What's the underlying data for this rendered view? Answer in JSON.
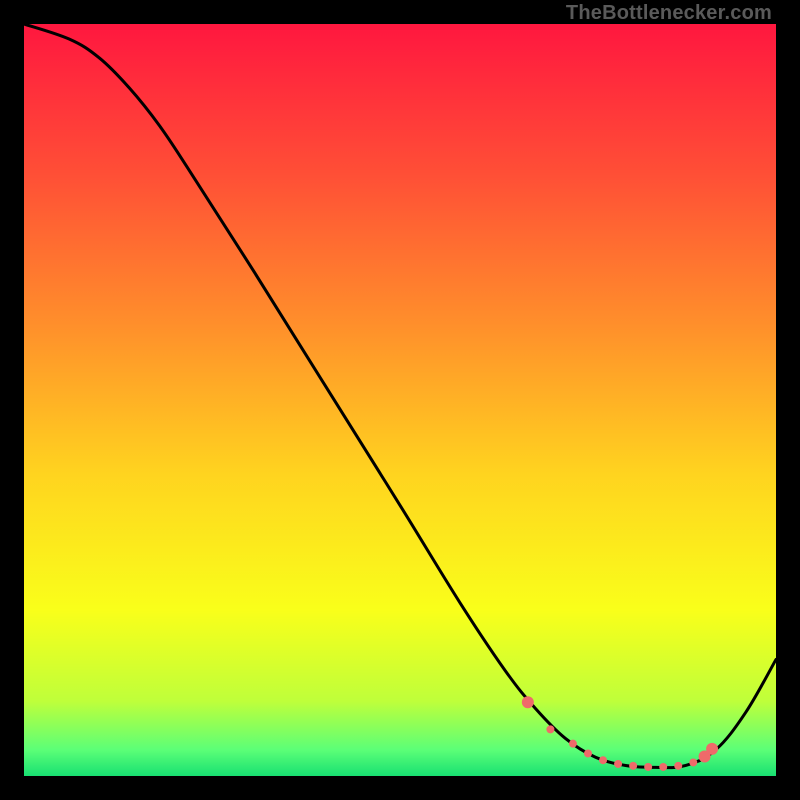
{
  "watermark": "TheBottlenecker.com",
  "chart_data": {
    "type": "line",
    "title": "",
    "xlabel": "",
    "ylabel": "",
    "xlim": [
      0,
      100
    ],
    "ylim": [
      0,
      100
    ],
    "grid": false,
    "legend": false,
    "background_gradient": {
      "stops": [
        {
          "offset": 0.0,
          "color": "#ff173f"
        },
        {
          "offset": 0.2,
          "color": "#ff4f36"
        },
        {
          "offset": 0.4,
          "color": "#ff8f2b"
        },
        {
          "offset": 0.6,
          "color": "#ffd41f"
        },
        {
          "offset": 0.78,
          "color": "#f9ff1a"
        },
        {
          "offset": 0.9,
          "color": "#bfff3a"
        },
        {
          "offset": 0.965,
          "color": "#5cff77"
        },
        {
          "offset": 1.0,
          "color": "#18e072"
        }
      ]
    },
    "curve": {
      "x": [
        0,
        6,
        10,
        14,
        18,
        22,
        30,
        40,
        50,
        58,
        64,
        68,
        72,
        76,
        80,
        84,
        88,
        92,
        96,
        100
      ],
      "y": [
        100,
        98,
        95.5,
        91.5,
        86.5,
        80.5,
        68,
        52,
        36,
        23,
        14,
        9,
        5,
        2.5,
        1.4,
        1.15,
        1.4,
        3.5,
        8.5,
        15.5
      ]
    },
    "markers": {
      "x": [
        67,
        70,
        73,
        75,
        77,
        79,
        81,
        83,
        85,
        87,
        89,
        90.5,
        91.5
      ],
      "y": [
        9.8,
        6.2,
        4.3,
        3.0,
        2.1,
        1.6,
        1.35,
        1.2,
        1.2,
        1.35,
        1.8,
        2.6,
        3.6
      ],
      "color": "#ef6a6a",
      "radius_large": 6,
      "radius_small": 4,
      "large_indices": [
        0,
        11,
        12
      ]
    }
  }
}
